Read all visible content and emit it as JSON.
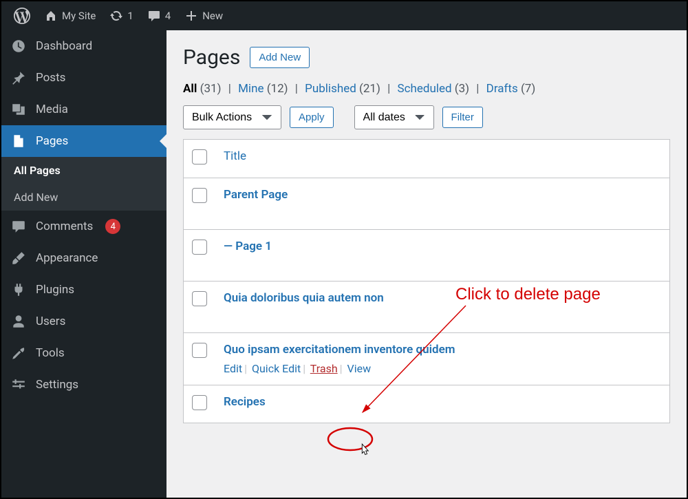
{
  "adminbar": {
    "site_name": "My Site",
    "updates": "1",
    "comments": "4",
    "new_label": "New"
  },
  "sidebar": {
    "items": [
      {
        "label": "Dashboard"
      },
      {
        "label": "Posts"
      },
      {
        "label": "Media"
      },
      {
        "label": "Pages"
      },
      {
        "label": "Comments",
        "badge": "4"
      },
      {
        "label": "Appearance"
      },
      {
        "label": "Plugins"
      },
      {
        "label": "Users"
      },
      {
        "label": "Tools"
      },
      {
        "label": "Settings"
      }
    ],
    "submenu": {
      "all_pages": "All Pages",
      "add_new": "Add New"
    }
  },
  "heading": {
    "title": "Pages",
    "add_new": "Add New"
  },
  "filters": {
    "all": {
      "label": "All",
      "count": "(31)"
    },
    "mine": {
      "label": "Mine",
      "count": "(12)"
    },
    "published": {
      "label": "Published",
      "count": "(21)"
    },
    "scheduled": {
      "label": "Scheduled",
      "count": "(3)"
    },
    "drafts": {
      "label": "Drafts",
      "count": "(7)"
    }
  },
  "tablenav": {
    "bulk": "Bulk Actions",
    "apply": "Apply",
    "dates": "All dates",
    "filter": "Filter"
  },
  "table": {
    "title_col": "Title",
    "rows": [
      {
        "title": "Parent Page"
      },
      {
        "title": "— Page 1"
      },
      {
        "title": "Quia doloribus quia autem non"
      },
      {
        "title": "Quo ipsam exercitationem inventore quidem",
        "show_actions": true
      },
      {
        "title": "Recipes"
      }
    ],
    "actions": {
      "edit": "Edit",
      "quick_edit": "Quick Edit",
      "trash": "Trash",
      "view": "View"
    }
  },
  "annotation": {
    "text": "Click to delete page"
  }
}
